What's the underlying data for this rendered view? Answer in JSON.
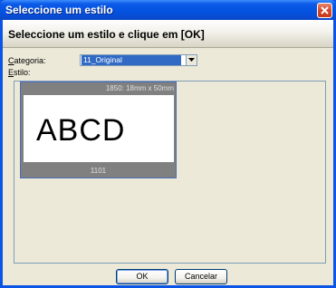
{
  "window": {
    "title": "Seleccione um estilo"
  },
  "header": {
    "instruction": "Seleccione um estilo e clique em [OK]"
  },
  "form": {
    "category_label_accel": "C",
    "category_label_rest": "ategoria:",
    "category_value": "11_Original",
    "style_label_accel": "E",
    "style_label_rest": "stilo:"
  },
  "style_card": {
    "size_text": "1850: 18mm x 50mm",
    "preview_text": "ABCD",
    "id_text": "1101"
  },
  "buttons": {
    "ok": "OK",
    "cancel": "Cancelar"
  },
  "icons": {
    "close": "close-icon",
    "dropdown": "chevron-down-icon"
  },
  "colors": {
    "titlebar": "#0a54e6",
    "selection": "#316ac5",
    "close": "#d5482a",
    "dialog_bg": "#ece9d8"
  }
}
